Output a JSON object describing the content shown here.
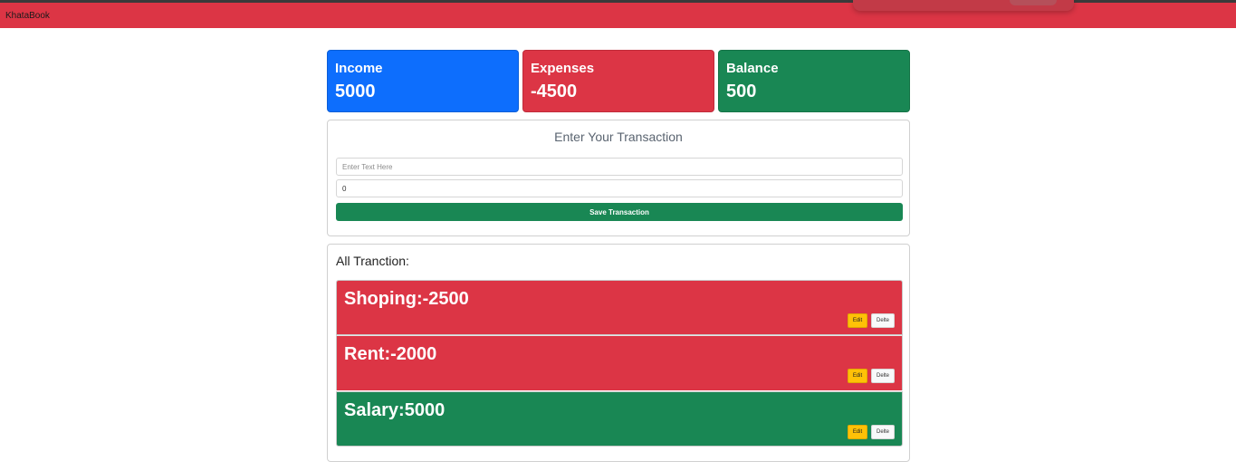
{
  "navbar": {
    "brand": "KhataBook"
  },
  "summary": {
    "income": {
      "label": "Income",
      "value": "5000"
    },
    "expenses": {
      "label": "Expenses",
      "value": "-4500"
    },
    "balance": {
      "label": "Balance",
      "value": "500"
    }
  },
  "form": {
    "title": "Enter Your Transaction",
    "text_placeholder": "Enter Text Here",
    "amount_value": "0",
    "save_label": "Save Transaction"
  },
  "transactions": {
    "title": "All Tranction:",
    "items": [
      {
        "label": "Shoping:-2500",
        "edit_label": "Edit",
        "delete_label": "Delte"
      },
      {
        "label": "Rent:-2000",
        "edit_label": "Edit",
        "delete_label": "Delte"
      },
      {
        "label": "Salary:5000",
        "edit_label": "Edit",
        "delete_label": "Delte"
      }
    ]
  },
  "colors": {
    "navbar": "#dc3545",
    "income": "#0d6efd",
    "expense": "#dc3545",
    "balance": "#198754",
    "edit": "#ffc107"
  }
}
